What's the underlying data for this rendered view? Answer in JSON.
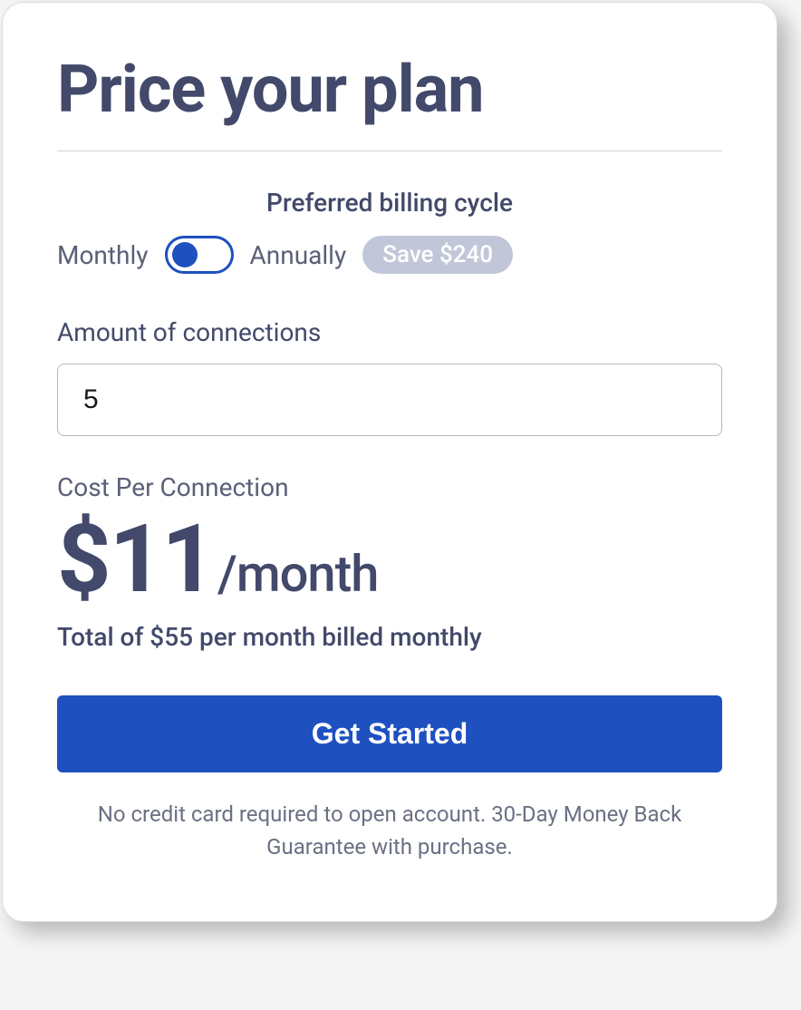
{
  "title": "Price your plan",
  "billing": {
    "label": "Preferred billing cycle",
    "option_monthly": "Monthly",
    "option_annually": "Annually",
    "save_badge": "Save $240",
    "selected": "monthly"
  },
  "connections": {
    "label": "Amount of connections",
    "value": "5"
  },
  "cost": {
    "label": "Cost Per Connection",
    "price": "$11",
    "period": "/month",
    "total": "Total of $55 per month billed monthly"
  },
  "cta": {
    "label": "Get Started"
  },
  "disclaimer": "No credit card required to open account. 30-Day Money Back Guarantee with purchase."
}
